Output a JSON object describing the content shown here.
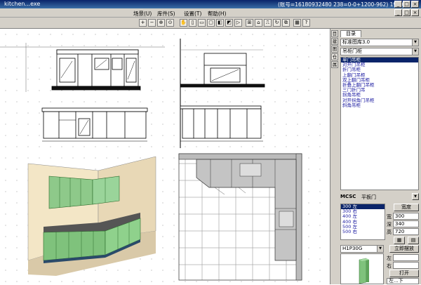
{
  "window": {
    "title": "kitchen...exe",
    "status": "(账号=16180932480 238=0-0+1200-962) 19:50"
  },
  "menu": [
    "场景(U)",
    "库件(S)",
    "设置(T)",
    "帮助(H)"
  ],
  "toolbar_icons": [
    "zoom-in",
    "zoom-out",
    "zoom-window",
    "zoom-all",
    "pan",
    "view-top",
    "view-front",
    "view-side",
    "view-3d",
    "render",
    "measure",
    "dimension",
    "select",
    "move",
    "rotate",
    "copy",
    "delete",
    "grid",
    "help"
  ],
  "panel": {
    "tab_label": "目录",
    "vertical_tabs": [
      "目",
      "建",
      "图",
      "仓",
      "属"
    ],
    "library_select": "标准图库3.0",
    "category_select": "吊柜门柜",
    "items": [
      "单门吊柜",
      "对开门吊柜",
      "折门吊柜",
      "上翻门吊柜",
      "双上翻门吊柜",
      "折叠上翻门吊柜",
      "三门折门吊",
      "拐角吊柜",
      "对开拐角门吊柜",
      "斜角吊柜"
    ],
    "selected_item_index": 0,
    "material_label": "MCSC",
    "door_type": "平板门",
    "sizes": [
      "300 左",
      "300 右",
      "400 左",
      "400 右",
      "500 左",
      "500 右"
    ],
    "selected_size_index": 0,
    "width_button": "宽度",
    "width_label": "宽",
    "width_value": "300",
    "depth_label": "深",
    "depth_value": "340",
    "height_label": "高",
    "height_value": "720",
    "model_select": "H1P30G",
    "place_button": "立即摆放",
    "left_label": "左",
    "right_label": "右",
    "open_button": "打开",
    "direction_select": "左...下"
  }
}
